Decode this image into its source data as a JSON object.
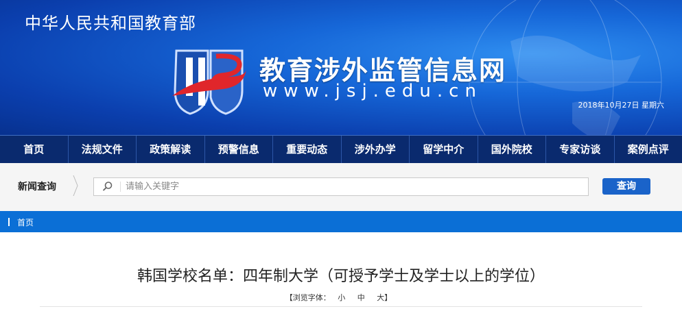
{
  "header": {
    "ministry": "中华人民共和国教育部",
    "site_title": "教育涉外监管信息网",
    "site_url": "www.jsj.edu.cn",
    "date": "2018年10月27日  星期六"
  },
  "nav": {
    "items": [
      "首页",
      "法规文件",
      "政策解读",
      "预警信息",
      "重要动态",
      "涉外办学",
      "留学中介",
      "国外院校",
      "专家访谈",
      "案例点评"
    ]
  },
  "search": {
    "label": "新闻查询",
    "placeholder": "请输入关键字",
    "button": "查询"
  },
  "breadcrumb": {
    "home": "首页"
  },
  "article": {
    "title": "韩国学校名单：四年制大学（可授予学士及学士以上的学位）",
    "font_prefix": "【浏览字体：",
    "font_small": "小",
    "font_medium": "中",
    "font_large": "大】"
  },
  "colors": {
    "nav_bg": "#0a2a6e",
    "accent": "#0b6fd6",
    "button": "#1a63c9"
  }
}
